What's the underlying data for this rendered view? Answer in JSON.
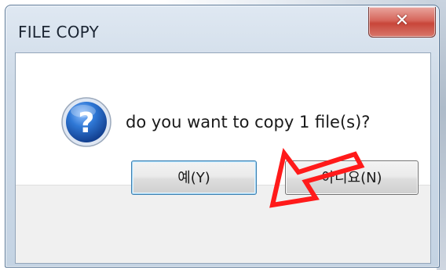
{
  "dialog": {
    "title": "FILE COPY",
    "close_glyph": "✕",
    "message": "do you want to copy 1 file(s)?",
    "icon": "question-icon",
    "buttons": {
      "yes_label": "예(Y)",
      "no_label": "아니요(N)"
    }
  },
  "annotation": {
    "arrow_color": "#ff1a1a",
    "points_to": "yes-button"
  },
  "colors": {
    "icon_blue": "#1f5fbf",
    "close_red": "#c8463a",
    "default_button_border": "#3c7fb1"
  }
}
